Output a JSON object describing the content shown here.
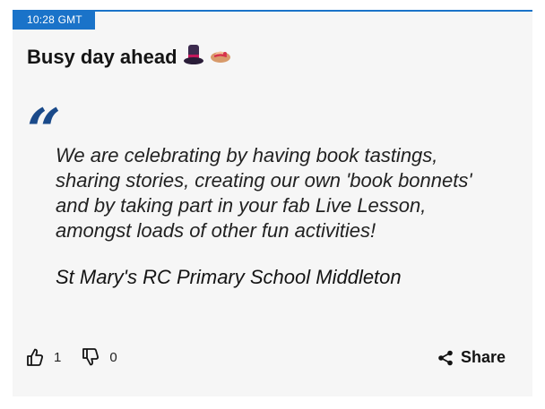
{
  "post": {
    "time": "10:28 GMT",
    "title": "Busy day ahead",
    "title_emojis": [
      "top-hat-icon",
      "bonnet-icon"
    ],
    "quote_mark": "“",
    "quote": "We are celebrating by having book tastings, sharing stories, creating our own 'book bonnets' and by taking part in your fab Live Lesson, amongst loads of other fun activities!",
    "source": "St Mary's RC Primary School Middleton"
  },
  "actions": {
    "like_count": "1",
    "dislike_count": "0",
    "share_label": "Share"
  },
  "colors": {
    "accent": "#1a73c9",
    "quote_mark": "#1a4a8a",
    "card_bg": "#f6f6f6"
  }
}
